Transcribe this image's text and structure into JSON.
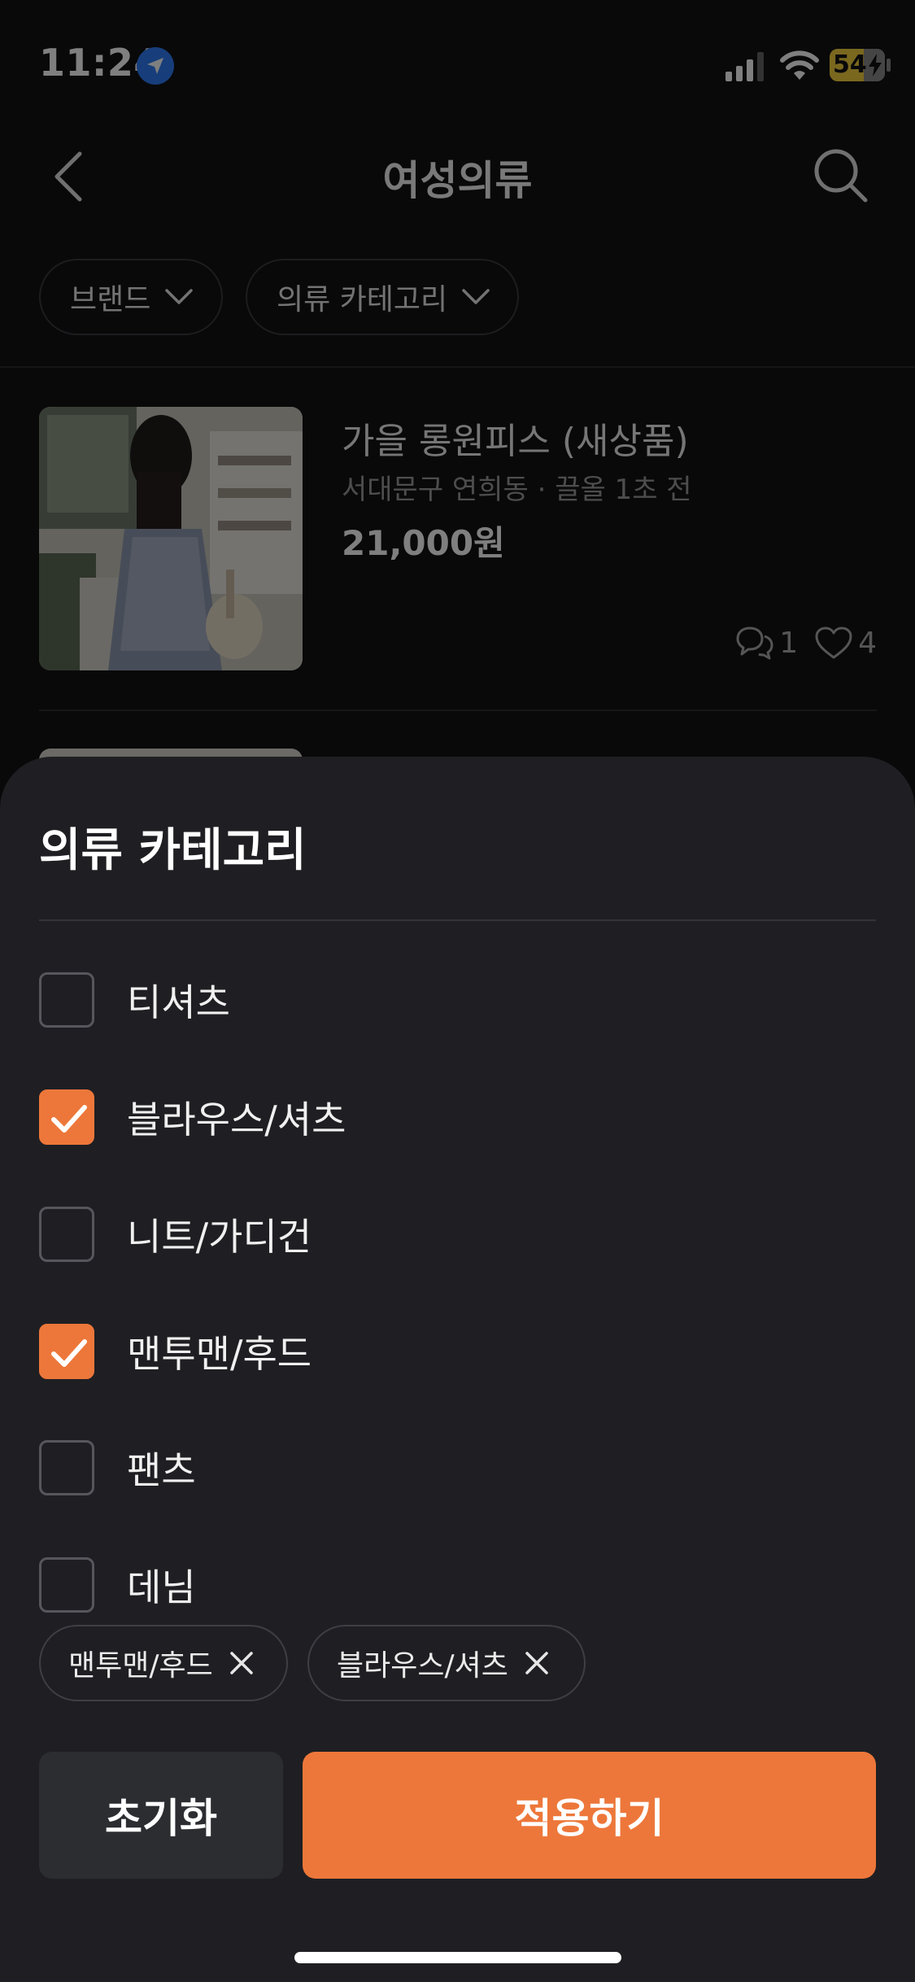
{
  "status_bar": {
    "time": "11:24",
    "battery": "54"
  },
  "header": {
    "title": "여성의류",
    "icons": {
      "back": "chevron-left-icon",
      "search": "search-icon"
    }
  },
  "filters": [
    {
      "label": "브랜드"
    },
    {
      "label": "의류 카테고리"
    }
  ],
  "listing": {
    "title": "가을 롱원피스 (새상품)",
    "meta": "서대문구 연희동 · 끌올 1초 전",
    "price": "21,000원",
    "comments": "1",
    "likes": "4"
  },
  "sheet": {
    "title": "의류 카테고리",
    "options": [
      {
        "label": "티셔츠",
        "checked": false
      },
      {
        "label": "블라우스/셔츠",
        "checked": true
      },
      {
        "label": "니트/가디건",
        "checked": false
      },
      {
        "label": "맨투맨/후드",
        "checked": true
      },
      {
        "label": "팬츠",
        "checked": false
      },
      {
        "label": "데님",
        "checked": false
      }
    ],
    "selected_chips": [
      {
        "label": "맨투맨/후드"
      },
      {
        "label": "블라우스/셔츠"
      }
    ],
    "reset_label": "초기화",
    "apply_label": "적용하기",
    "accent_color": "#ED773A"
  }
}
